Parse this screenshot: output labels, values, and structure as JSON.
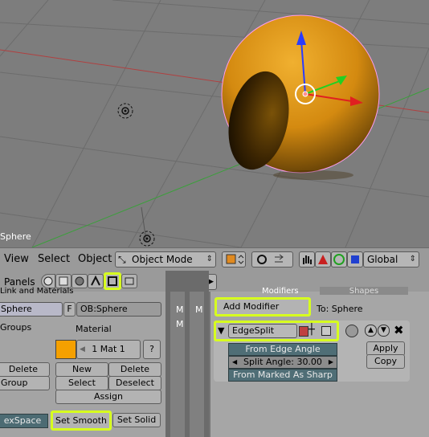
{
  "viewport": {
    "object_name": "Sphere"
  },
  "header": {
    "menus": [
      "View",
      "Select",
      "Object"
    ],
    "mode": "Object Mode",
    "orientation": "Global"
  },
  "panelbar": {
    "panels_label": "Panels",
    "frame": "1"
  },
  "link_materials": {
    "tab_label": "Link and Materials",
    "mesh_name": "Sphere",
    "f_label": "F",
    "ob_name": "OB:Sphere",
    "vertex_groups_label": "Groups",
    "material_label": "Material",
    "mat_slot": "1 Mat 1",
    "question": "?",
    "left_delete": "Delete",
    "left_group": "Group",
    "new": "New",
    "delete": "Delete",
    "select": "Select",
    "deselect": "Deselect",
    "assign": "Assign",
    "texspace": "exSpace",
    "set_smooth": "Set Smooth",
    "set_solid": "Set Solid"
  },
  "modifiers": {
    "m_labels": [
      "M",
      "M",
      "M"
    ],
    "tab_modifiers": "Modifiers",
    "tab_shapes": "Shapes",
    "add_modifier": "Add Modifier",
    "to_label": "To: Sphere",
    "modifier_name": "EdgeSplit",
    "from_edge_angle": "From Edge Angle",
    "split_angle": "Split Angle: 30.00",
    "from_marked_sharp": "From Marked As Sharp",
    "apply": "Apply",
    "copy": "Copy"
  },
  "colors": {
    "highlight": "#d7ff1e",
    "sphere": "#d08a10",
    "material_swatch": "#f5a000"
  }
}
